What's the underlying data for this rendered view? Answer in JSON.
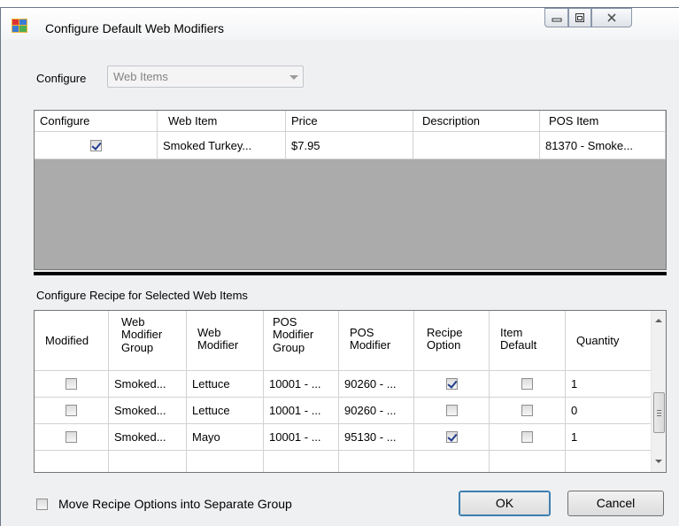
{
  "window": {
    "title": "Configure Default Web Modifiers"
  },
  "configure": {
    "label": "Configure",
    "selected": "Web Items"
  },
  "web_items_grid": {
    "columns": [
      "Configure",
      "Web Item",
      "Price",
      "Description",
      "POS Item"
    ],
    "rows": [
      {
        "configure": true,
        "web_item": "Smoked Turkey...",
        "price": "$7.95",
        "description": "",
        "pos_item": "81370 - Smoke..."
      }
    ]
  },
  "recipe_section": {
    "label": "Configure Recipe for Selected Web Items",
    "columns": {
      "modified": "Modified",
      "web_modifier_group": "Web Modifier Group",
      "web_modifier": "Web Modifier",
      "pos_modifier_group": "POS Modifier Group",
      "pos_modifier": "POS Modifier",
      "recipe_option": "Recipe Option",
      "item_default": "Item Default",
      "quantity": "Quantity"
    },
    "rows": [
      {
        "modified": false,
        "web_modifier_group": "Smoked...",
        "web_modifier": "Lettuce",
        "pos_modifier_group": "10001 - ...",
        "pos_modifier": "90260 - ...",
        "recipe_option": true,
        "item_default": false,
        "quantity": "1"
      },
      {
        "modified": false,
        "web_modifier_group": "Smoked...",
        "web_modifier": "Lettuce",
        "pos_modifier_group": "10001 - ...",
        "pos_modifier": "90260 - ...",
        "recipe_option": false,
        "item_default": false,
        "quantity": "0"
      },
      {
        "modified": false,
        "web_modifier_group": "Smoked...",
        "web_modifier": "Mayo",
        "pos_modifier_group": "10001 - ...",
        "pos_modifier": "95130 - ...",
        "recipe_option": true,
        "item_default": false,
        "quantity": "1"
      }
    ]
  },
  "move_options": {
    "label": "Move Recipe Options into Separate Group",
    "checked": false
  },
  "buttons": {
    "ok": "OK",
    "cancel": "Cancel"
  },
  "icons": {
    "app": "app-window-icon",
    "minimize": "minimize-icon",
    "maximize": "maximize-icon",
    "close": "close-icon"
  }
}
